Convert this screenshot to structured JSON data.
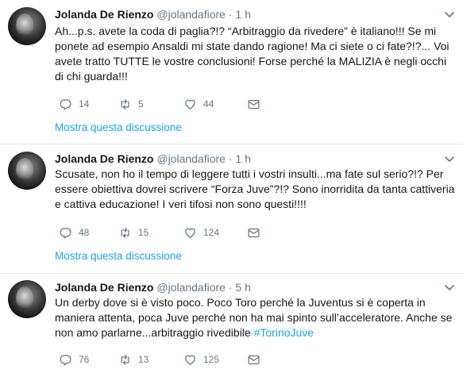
{
  "colors": {
    "link": "#1da1f2",
    "muted": "#657786",
    "text": "#14171a",
    "separator": "#e6ecf0"
  },
  "tweets": [
    {
      "name": "Jolanda De Rienzo",
      "handle": "@jolandafiore",
      "dot": "·",
      "time": "1 h",
      "text": "Ah...p.s. avete la coda di paglia?!? “Arbitraggio da rivedere” è italiano!!! Se mi ponete ad esempio Ansaldi mi state dando ragione! Ma ci siete o ci fate?!?... Voi avete tratto TUTTE le vostre conclusioni! Forse perché la MALIZIA è negli occhi di chi guarda!!!",
      "hashtag": "",
      "replies": "14",
      "retweets": "5",
      "likes": "44",
      "thread_label": "Mostra questa discussione"
    },
    {
      "name": "Jolanda De Rienzo",
      "handle": "@jolandafiore",
      "dot": "·",
      "time": "1 h",
      "text": "Scusate, non ho il tempo di leggere tutti i vostri insulti...ma fate sul serio?!? Per essere obiettiva dovrei scrivere “Forza Juve”?!? Sono inorridita da tanta cattiveria e cattiva educazione! I veri tifosi non sono questi!!!!",
      "hashtag": "",
      "replies": "48",
      "retweets": "15",
      "likes": "124",
      "thread_label": "Mostra questa discussione"
    },
    {
      "name": "Jolanda De Rienzo",
      "handle": "@jolandafiore",
      "dot": "·",
      "time": "5 h",
      "text": "Un derby dove si è visto poco. Poco Toro perché la Juventus si è coperta in maniera attenta, poca Juve perché non ha mai spinto sull’acceleratore. Anche se non amo parlarne...arbitraggio rivedibile ",
      "hashtag": "#TorinoJuve",
      "replies": "76",
      "retweets": "13",
      "likes": "125",
      "thread_label": ""
    }
  ],
  "icons": {
    "reply": "reply-icon",
    "retweet": "retweet-icon",
    "like": "heart-icon",
    "message": "envelope-icon",
    "caret": "chevron-down-icon"
  }
}
